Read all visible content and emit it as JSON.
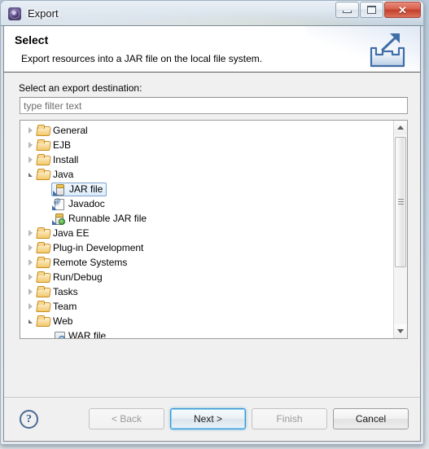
{
  "window": {
    "title": "Export",
    "icon": "eclipse-gear-icon",
    "controls": {
      "minimize": "minimize-icon",
      "maximize": "maximize-icon",
      "close": "✕"
    }
  },
  "header": {
    "title": "Select",
    "description": "Export resources into a JAR file on the local file system.",
    "icon": "export-wizard-icon"
  },
  "body": {
    "destination_label": "Select an export destination:",
    "filter": {
      "value": "",
      "placeholder": "type filter text"
    }
  },
  "tree": {
    "items": [
      {
        "label": "General",
        "level": 0,
        "state": "collapsed",
        "icon": "folder-icon",
        "selected": false
      },
      {
        "label": "EJB",
        "level": 0,
        "state": "collapsed",
        "icon": "folder-icon",
        "selected": false
      },
      {
        "label": "Install",
        "level": 0,
        "state": "collapsed",
        "icon": "folder-icon",
        "selected": false
      },
      {
        "label": "Java",
        "level": 0,
        "state": "expanded",
        "icon": "folder-icon",
        "selected": false
      },
      {
        "label": "JAR file",
        "level": 1,
        "state": "leaf",
        "icon": "jar-file-icon",
        "selected": true
      },
      {
        "label": "Javadoc",
        "level": 1,
        "state": "leaf",
        "icon": "javadoc-icon",
        "selected": false
      },
      {
        "label": "Runnable JAR file",
        "level": 1,
        "state": "leaf",
        "icon": "runnable-jar-icon",
        "selected": false
      },
      {
        "label": "Java EE",
        "level": 0,
        "state": "collapsed",
        "icon": "folder-icon",
        "selected": false
      },
      {
        "label": "Plug-in Development",
        "level": 0,
        "state": "collapsed",
        "icon": "folder-icon",
        "selected": false
      },
      {
        "label": "Remote Systems",
        "level": 0,
        "state": "collapsed",
        "icon": "folder-icon",
        "selected": false
      },
      {
        "label": "Run/Debug",
        "level": 0,
        "state": "collapsed",
        "icon": "folder-icon",
        "selected": false
      },
      {
        "label": "Tasks",
        "level": 0,
        "state": "collapsed",
        "icon": "folder-icon",
        "selected": false
      },
      {
        "label": "Team",
        "level": 0,
        "state": "collapsed",
        "icon": "folder-icon",
        "selected": false
      },
      {
        "label": "Web",
        "level": 0,
        "state": "expanded",
        "icon": "folder-icon",
        "selected": false
      },
      {
        "label": "WAR file",
        "level": 1,
        "state": "leaf",
        "icon": "war-file-icon",
        "selected": false
      }
    ],
    "scrollbar": {
      "up_arrow": "▲",
      "down_arrow": "▼"
    }
  },
  "footer": {
    "help_label": "?",
    "buttons": [
      {
        "label": "< Back",
        "name": "back-button",
        "state": "disabled"
      },
      {
        "label": "Next >",
        "name": "next-button",
        "state": "default"
      },
      {
        "label": "Finish",
        "name": "finish-button",
        "state": "disabled"
      },
      {
        "label": "Cancel",
        "name": "cancel-button",
        "state": "normal"
      }
    ]
  },
  "colors": {
    "selection_border": "#7da2ce",
    "selection_fill": "#dcecfb",
    "default_button_glow": "#3c97d4",
    "close_button": "#c33f2c",
    "folder": "#f3c96a"
  }
}
